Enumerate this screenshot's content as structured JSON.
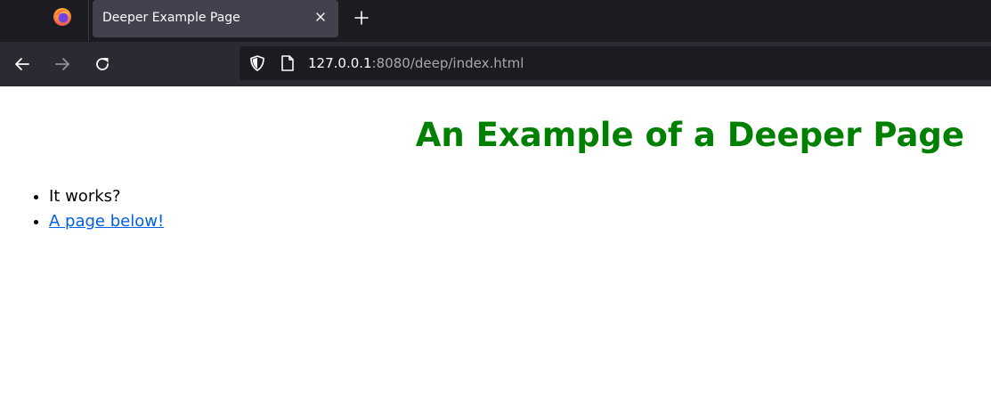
{
  "browser": {
    "tab": {
      "title": "Deeper Example Page"
    },
    "url": {
      "host": "127.0.0.1",
      "rest": ":8080/deep/index.html"
    },
    "icons": {
      "logo": "firefox-logo",
      "tab_close": "close-icon",
      "new_tab": "plus-icon",
      "back": "arrow-left-icon",
      "forward": "arrow-right-icon",
      "reload": "reload-icon",
      "shield": "shield-icon",
      "page": "page-icon"
    },
    "colors": {
      "tab_strip_bg": "#1c1b22",
      "active_tab_bg": "#42414d",
      "nav_bar_bg": "#2b2a33",
      "url_bar_bg": "#1c1b22"
    }
  },
  "page": {
    "heading": "An Example of a Deeper Page",
    "heading_color": "#008000",
    "items": [
      {
        "text": "It works?",
        "is_link": false
      },
      {
        "text": "A page below!",
        "is_link": true
      }
    ],
    "link_color": "#0060df"
  }
}
